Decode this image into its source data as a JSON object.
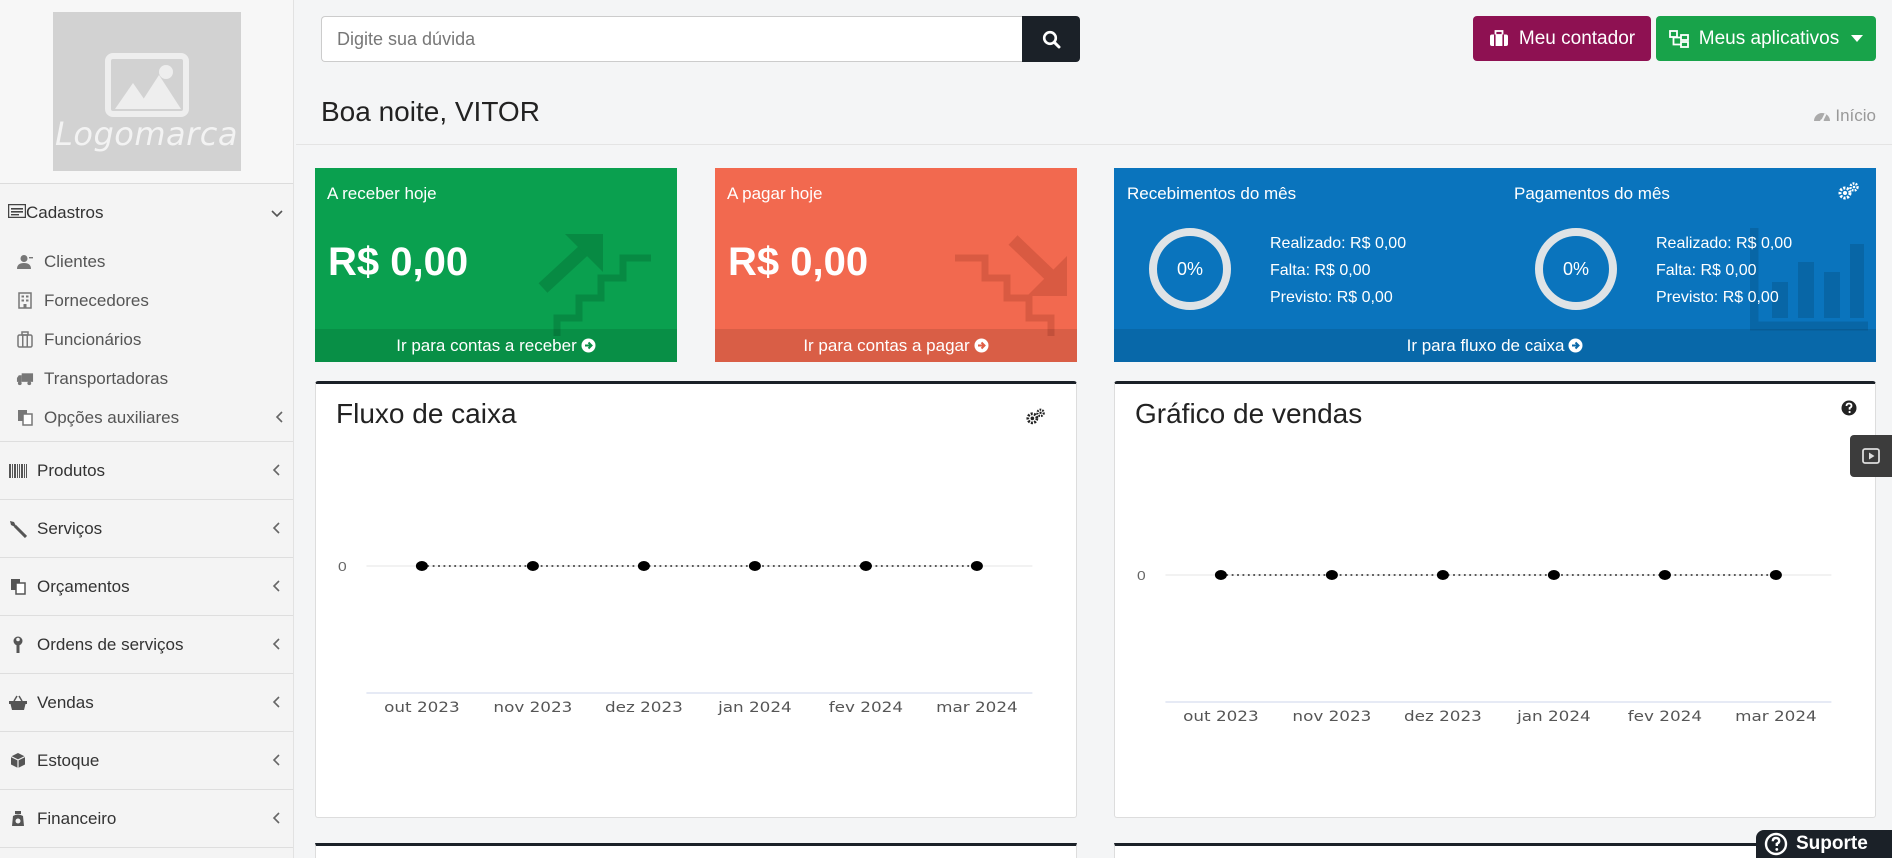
{
  "sidebar": {
    "logo_text": "Logomarca",
    "cadastros": {
      "label": "Cadastros",
      "items": [
        {
          "label": "Clientes",
          "icon": "user-icon"
        },
        {
          "label": "Fornecedores",
          "icon": "building-icon"
        },
        {
          "label": "Funcionários",
          "icon": "suitcase-icon"
        },
        {
          "label": "Transportadoras",
          "icon": "truck-icon"
        },
        {
          "label": "Opções auxiliares",
          "icon": "copy-icon"
        }
      ]
    },
    "menu": [
      {
        "label": "Produtos",
        "icon": "barcode-icon"
      },
      {
        "label": "Serviços",
        "icon": "screwdriver-icon"
      },
      {
        "label": "Orçamentos",
        "icon": "copy-icon"
      },
      {
        "label": "Ordens de serviços",
        "icon": "wrench-icon"
      },
      {
        "label": "Vendas",
        "icon": "basket-icon"
      },
      {
        "label": "Estoque",
        "icon": "cube-icon"
      },
      {
        "label": "Financeiro",
        "icon": "money-icon"
      }
    ]
  },
  "topbar": {
    "search_placeholder": "Digite sua dúvida",
    "contador_label": "Meu contador",
    "apps_label": "Meus aplicativos"
  },
  "header": {
    "greeting": "Boa noite, VITOR",
    "breadcrumb": "Início"
  },
  "boxes": {
    "receber": {
      "title": "A receber hoje",
      "amount": "R$ 0,00",
      "link": "Ir para contas a receber"
    },
    "pagar": {
      "title": "A pagar hoje",
      "amount": "R$ 0,00",
      "link": "Ir para contas a pagar"
    },
    "fluxo": {
      "recebimentos_title": "Recebimentos do mês",
      "recebimentos_pct": "0%",
      "recebimentos_lines": [
        "Realizado: R$ 0,00",
        "Falta: R$ 0,00",
        "Previsto: R$ 0,00"
      ],
      "pagamentos_title": "Pagamentos do mês",
      "pagamentos_pct": "0%",
      "pagamentos_lines": [
        "Realizado: R$ 0,00",
        "Falta: R$ 0,00",
        "Previsto: R$ 0,00"
      ],
      "link": "Ir para fluxo de caixa"
    }
  },
  "panels": {
    "fluxo_caixa": {
      "title": "Fluxo de caixa"
    },
    "grafico_vendas": {
      "title": "Gráfico de vendas"
    }
  },
  "support_label": "Suporte",
  "colors": {
    "green": "#0aa04f",
    "red": "#f2694f",
    "blue": "#0a74bd",
    "contador": "#8e1152",
    "apps": "#18a34a",
    "dark": "#1b2128"
  },
  "chart_data": [
    {
      "type": "line",
      "title": "Fluxo de caixa",
      "x": [
        "out 2023",
        "nov 2023",
        "dez 2023",
        "jan 2024",
        "fev 2024",
        "mar 2024"
      ],
      "series": [
        {
          "values": [
            0,
            0,
            0,
            0,
            0,
            0
          ]
        }
      ],
      "y_ticks": [
        "0"
      ],
      "grid": true
    },
    {
      "type": "line",
      "title": "Gráfico de vendas",
      "x": [
        "out 2023",
        "nov 2023",
        "dez 2023",
        "jan 2024",
        "fev 2024",
        "mar 2024"
      ],
      "series": [
        {
          "values": [
            0,
            0,
            0,
            0,
            0,
            0
          ]
        }
      ],
      "y_ticks": [
        "0"
      ],
      "grid": true
    }
  ]
}
